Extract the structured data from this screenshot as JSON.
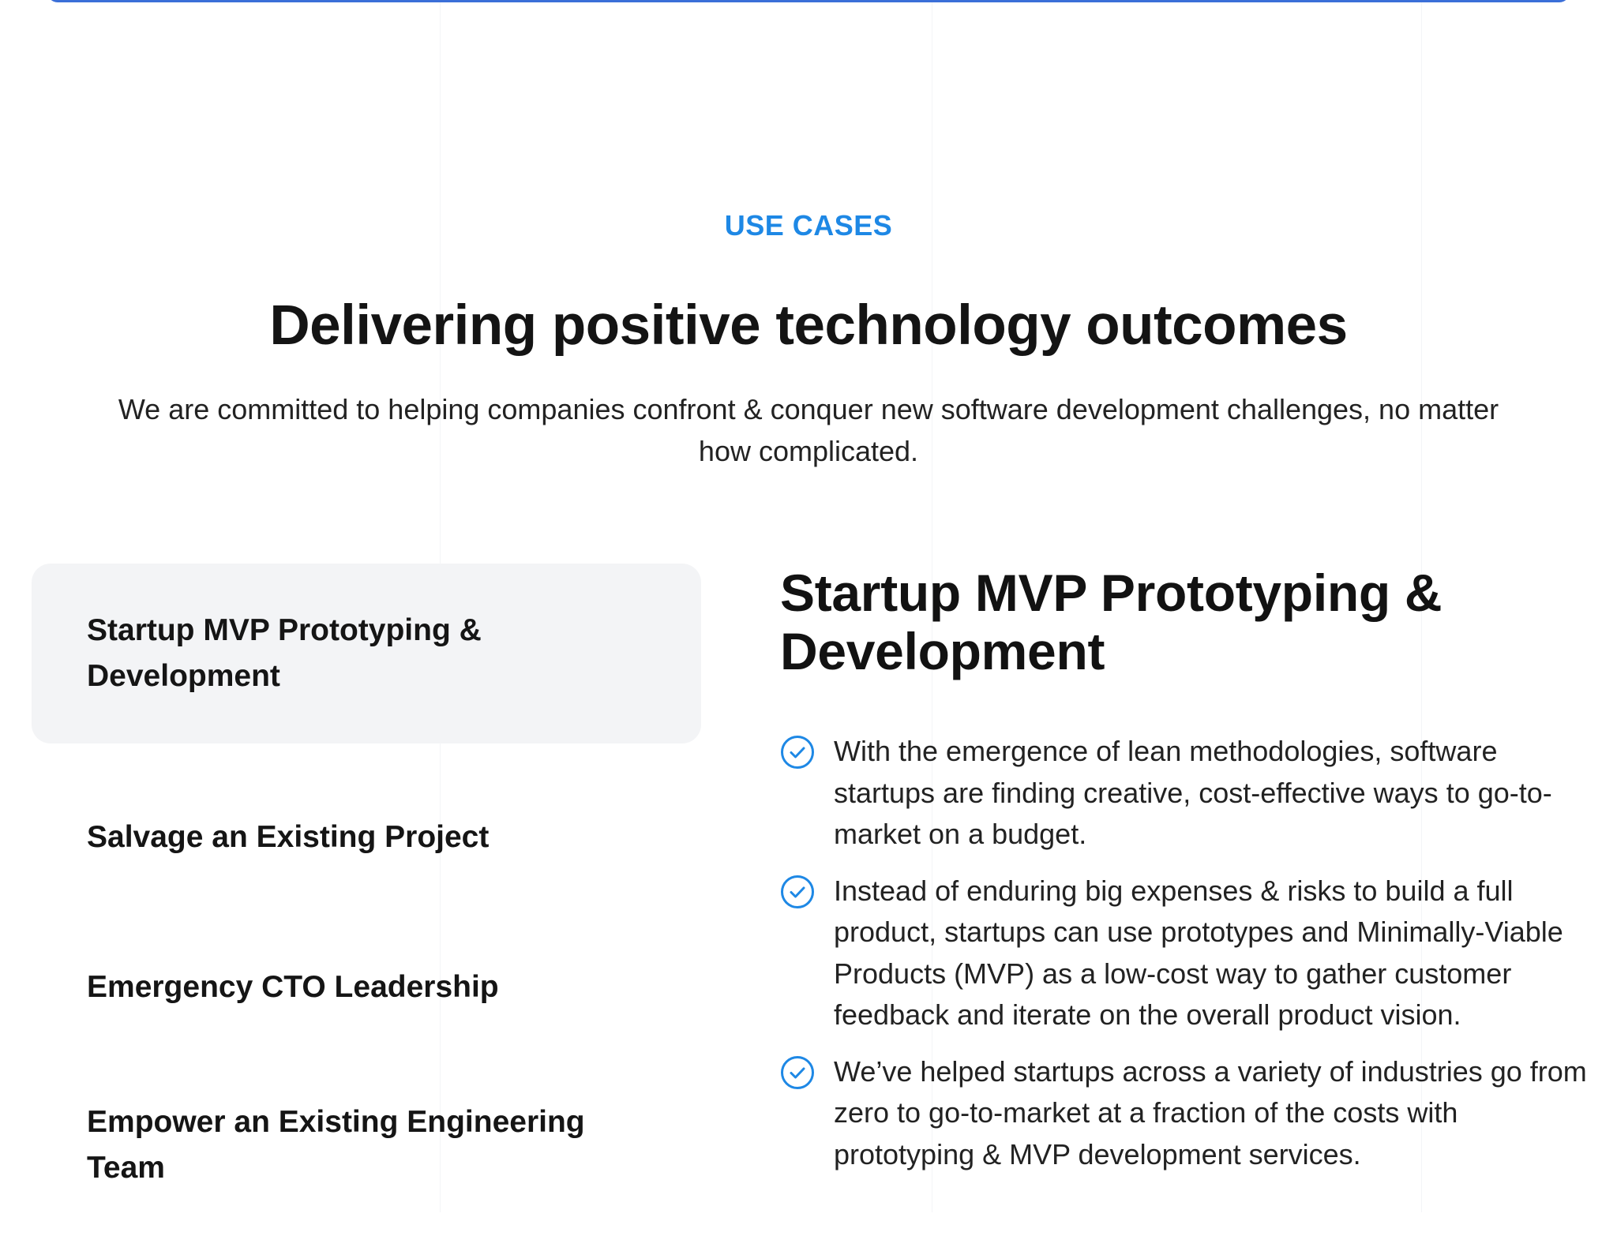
{
  "section": {
    "eyebrow": "USE CASES",
    "headline": "Delivering positive technology outcomes",
    "intro": "We are committed to helping companies confront & conquer new software development challenges, no matter how complicated."
  },
  "use_cases": {
    "selected": "Startup MVP Prototyping & Development",
    "items": [
      {
        "label": "Startup MVP Prototyping & Development"
      },
      {
        "label": "Salvage an Existing Project"
      },
      {
        "label": "Emergency CTO Leadership"
      },
      {
        "label": "Empower an Existing Engineering Team"
      }
    ]
  },
  "detail": {
    "title": "Startup MVP Prototyping & Development",
    "points": [
      "With the emergence of lean methodologies, software startups are finding creative, cost-effective ways to go-to-market on a budget.",
      "Instead of enduring big expenses & risks to build a full product, startups can use prototypes and Minimally-Viable Products (MVP) as a low-cost way to gather customer feedback and iterate on the overall product vision.",
      "We’ve helped startups across a variety of industries go from zero to go-to-market at a fraction of the costs with prototyping & MVP development services."
    ],
    "point_icon": "check-circle-icon"
  },
  "colors": {
    "accent": "#1e88e5",
    "text": "#161616",
    "active_tab_bg": "#f3f4f6",
    "top_border": "#3b6fd8"
  }
}
